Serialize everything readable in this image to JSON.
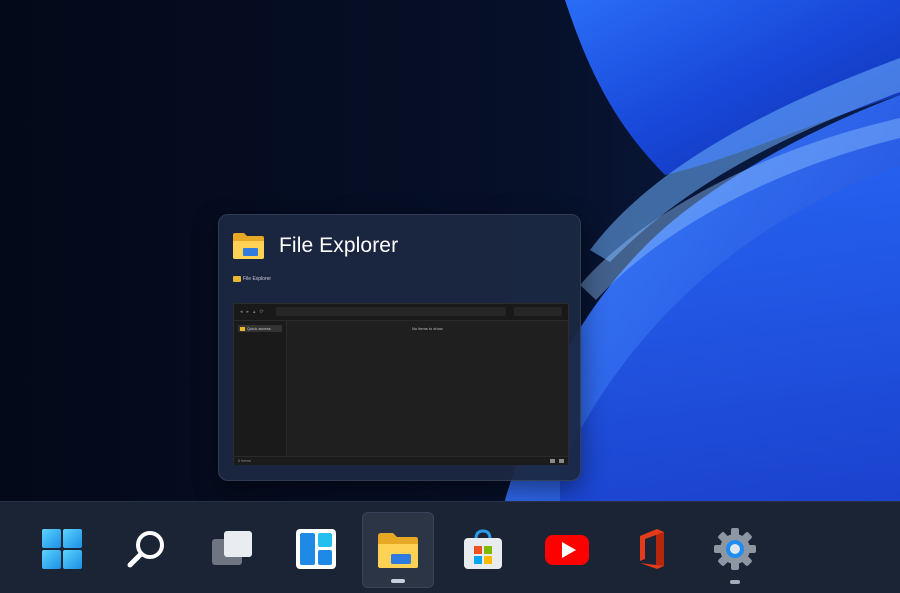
{
  "wallpaper": {
    "base_color": "#050b1c",
    "accent_color": "#1e55f0"
  },
  "preview": {
    "title": "File Explorer",
    "thumbnail": {
      "caption": "File Explorer",
      "nav_item": "Quick access",
      "content_text": "No items to show",
      "status_text": "0 items"
    }
  },
  "taskbar": {
    "items": [
      {
        "icon": "windows-start-icon",
        "running": false,
        "active": false
      },
      {
        "icon": "search-icon",
        "running": false,
        "active": false
      },
      {
        "icon": "task-view-icon",
        "running": false,
        "active": false
      },
      {
        "icon": "widgets-icon",
        "running": false,
        "active": false
      },
      {
        "icon": "file-explorer-icon",
        "running": true,
        "active": true
      },
      {
        "icon": "microsoft-store-icon",
        "running": false,
        "active": false
      },
      {
        "icon": "youtube-icon",
        "running": false,
        "active": false
      },
      {
        "icon": "office-icon",
        "running": false,
        "active": false
      },
      {
        "icon": "settings-gear-icon",
        "running": true,
        "active": false
      }
    ]
  }
}
